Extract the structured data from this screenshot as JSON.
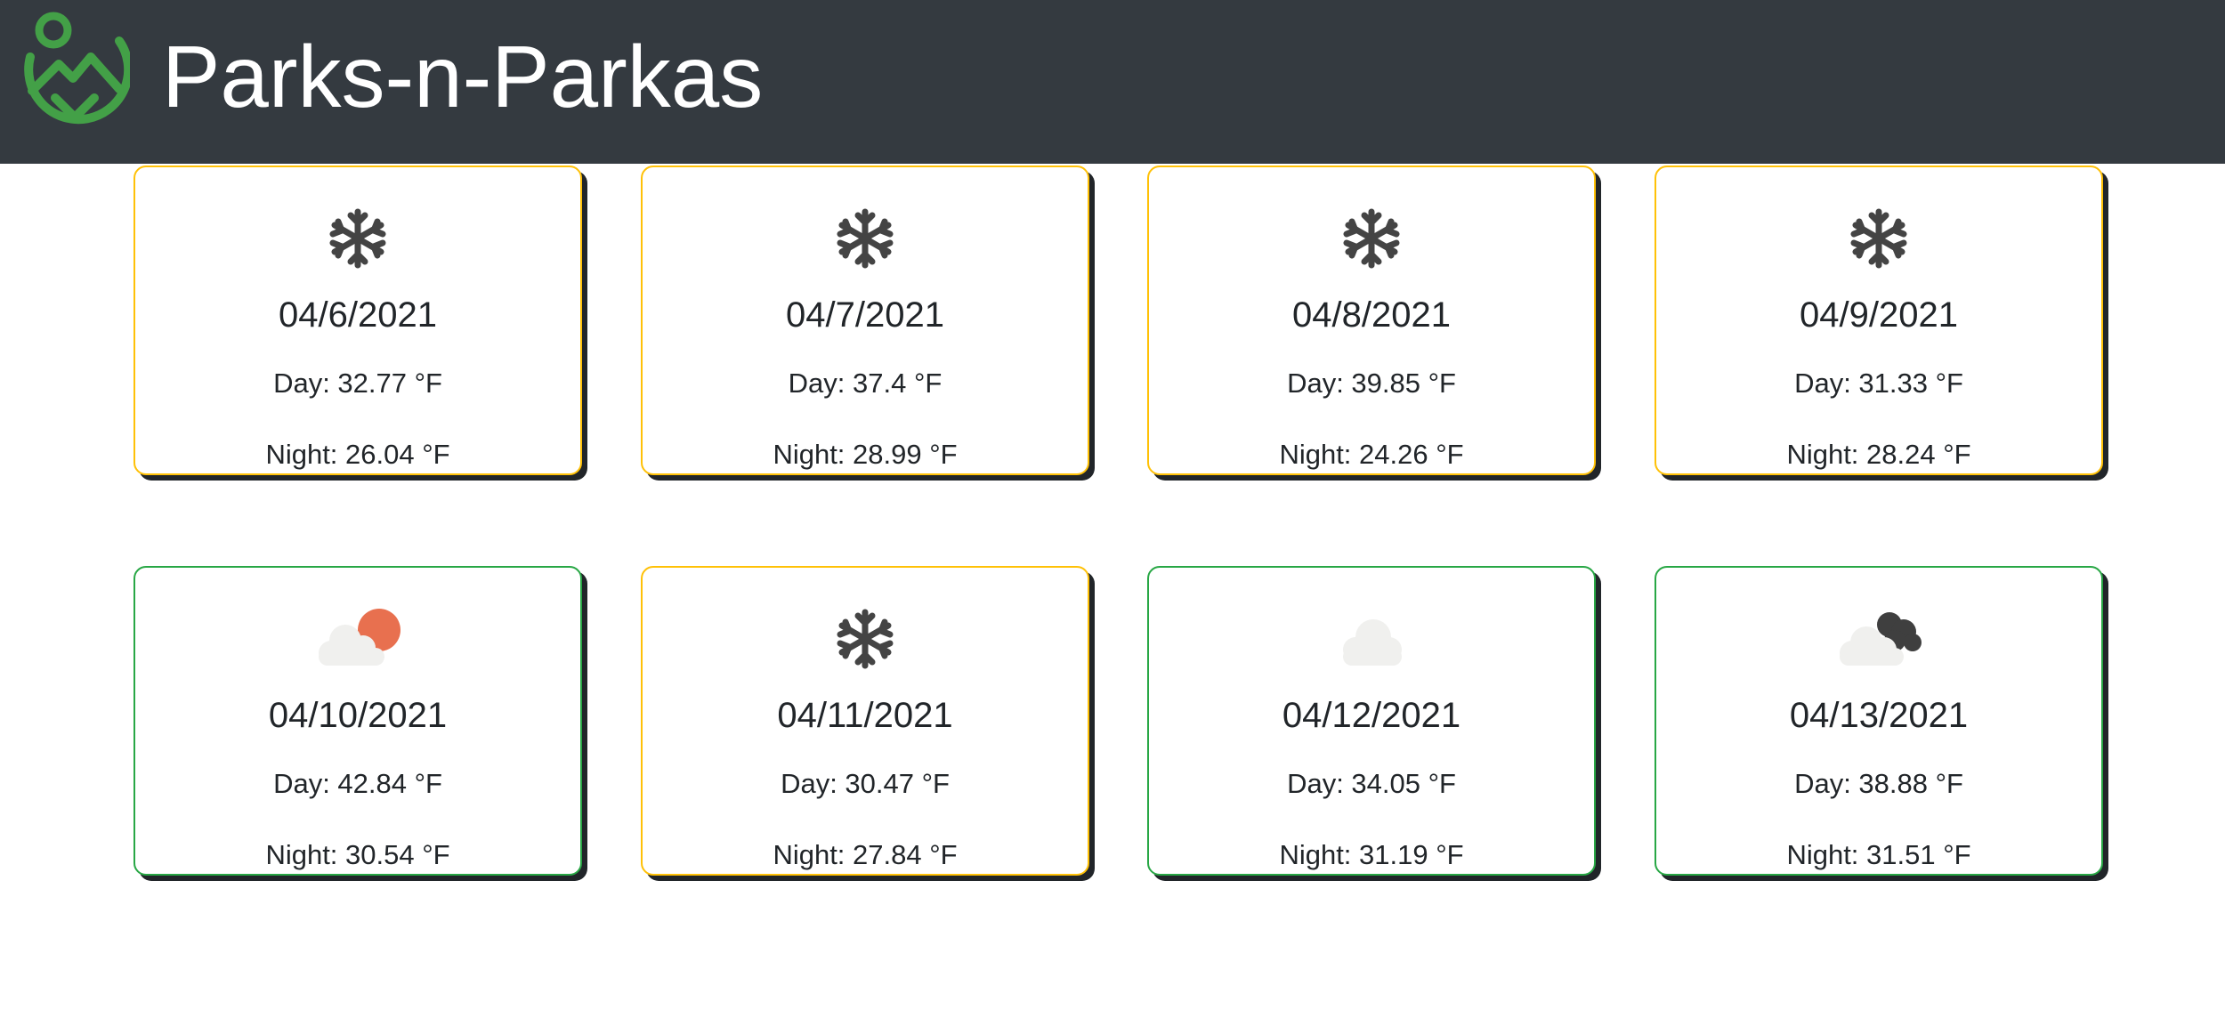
{
  "header": {
    "brand": "Parks-n-Parkas",
    "logo_icon": "mountain-pin-logo-icon",
    "logo_color": "#43a047",
    "background_color": "#343a40"
  },
  "forecast": [
    {
      "date": "04/6/2021",
      "day": "Day: 32.77 °F",
      "night": "Night: 26.04 °F",
      "icon": "snowflake-icon",
      "border": "#ffc107"
    },
    {
      "date": "04/7/2021",
      "day": "Day: 37.4 °F",
      "night": "Night: 28.99 °F",
      "icon": "snowflake-icon",
      "border": "#ffc107"
    },
    {
      "date": "04/8/2021",
      "day": "Day: 39.85 °F",
      "night": "Night: 24.26 °F",
      "icon": "snowflake-icon",
      "border": "#ffc107"
    },
    {
      "date": "04/9/2021",
      "day": "Day: 31.33 °F",
      "night": "Night: 28.24 °F",
      "icon": "snowflake-icon",
      "border": "#ffc107"
    },
    {
      "date": "04/10/2021",
      "day": "Day: 42.84 °F",
      "night": "Night: 30.54 °F",
      "icon": "partly-sunny-cloud-icon",
      "border": "#28a745"
    },
    {
      "date": "04/11/2021",
      "day": "Day: 30.47 °F",
      "night": "Night: 27.84 °F",
      "icon": "snowflake-icon",
      "border": "#ffc107"
    },
    {
      "date": "04/12/2021",
      "day": "Day: 34.05 °F",
      "night": "Night: 31.19 °F",
      "icon": "cloud-icon",
      "border": "#28a745"
    },
    {
      "date": "04/13/2021",
      "day": "Day: 38.88 °F",
      "night": "Night: 31.51 °F",
      "icon": "dark-clouds-icon",
      "border": "#28a745"
    }
  ]
}
